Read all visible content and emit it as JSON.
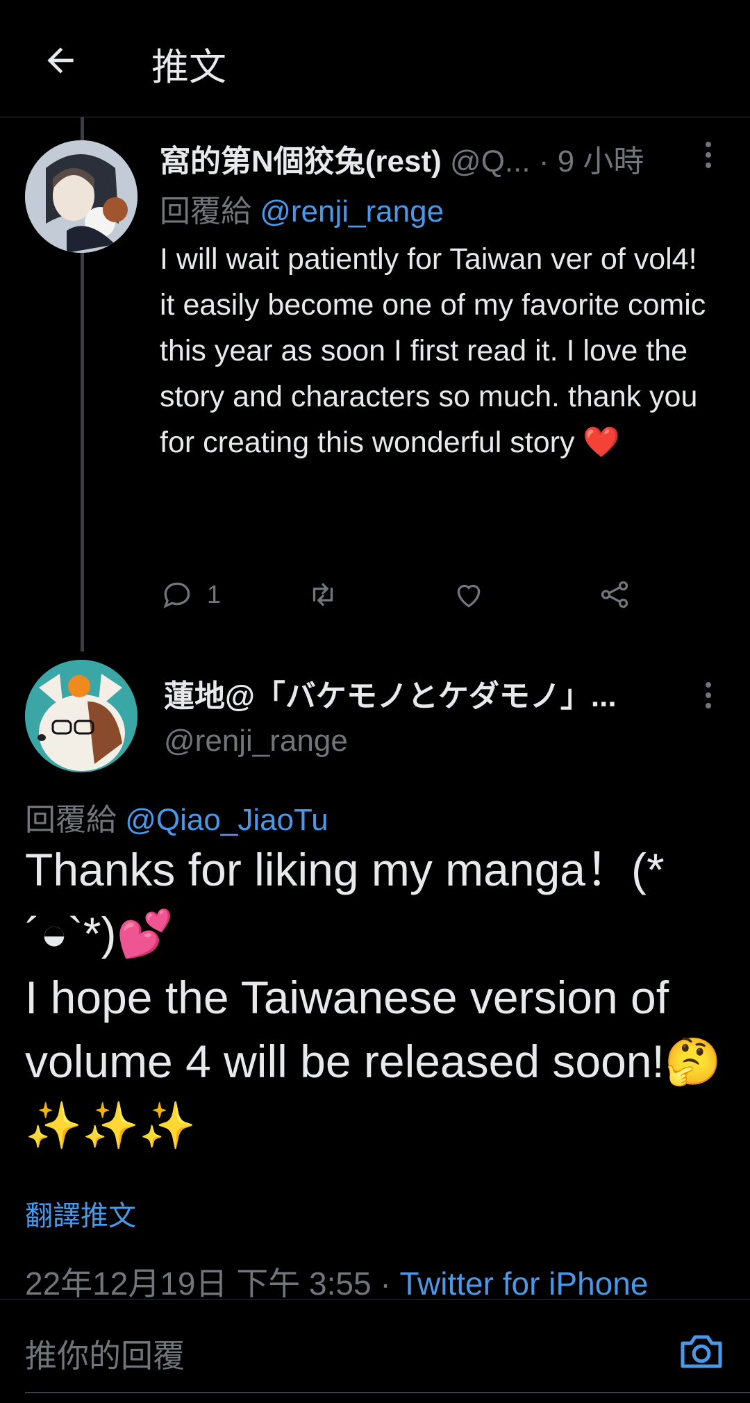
{
  "header": {
    "title": "推文"
  },
  "tweet1": {
    "display_name": "窩的第N個狡兔(rest)",
    "handle_truncated": "@Q...",
    "time": "· 9 小時",
    "reply_prefix": "回覆給",
    "reply_to": "@renji_range",
    "body_lines": [
      "I will wait patiently for Taiwan ver of vol4!",
      "it easily become one of my favorite comic this year as soon I first read it. I love the story and characters so much. thank you for creating this wonderful story ❤️"
    ],
    "reply_count": "1"
  },
  "tweet2": {
    "display_name": "蓮地@「バケモノとケダモノ」...",
    "handle": "@renji_range",
    "reply_prefix": "回覆給",
    "reply_to": "@Qiao_JiaoTu",
    "body_line1": "Thanks for liking my manga！(*´◒`*)💕",
    "body_line2": "I hope the Taiwanese version of volume 4 will be released soon!🤔✨✨✨",
    "translate": "翻譯推文",
    "timestamp": "22年12月19日 下午 3:55 ·",
    "source": "Twitter for iPhone"
  },
  "composer": {
    "placeholder": "推你的回覆"
  },
  "colors": {
    "background": "#000000",
    "link": "#4a99e9",
    "muted": "#71767b",
    "text": "#e7e9ea"
  }
}
